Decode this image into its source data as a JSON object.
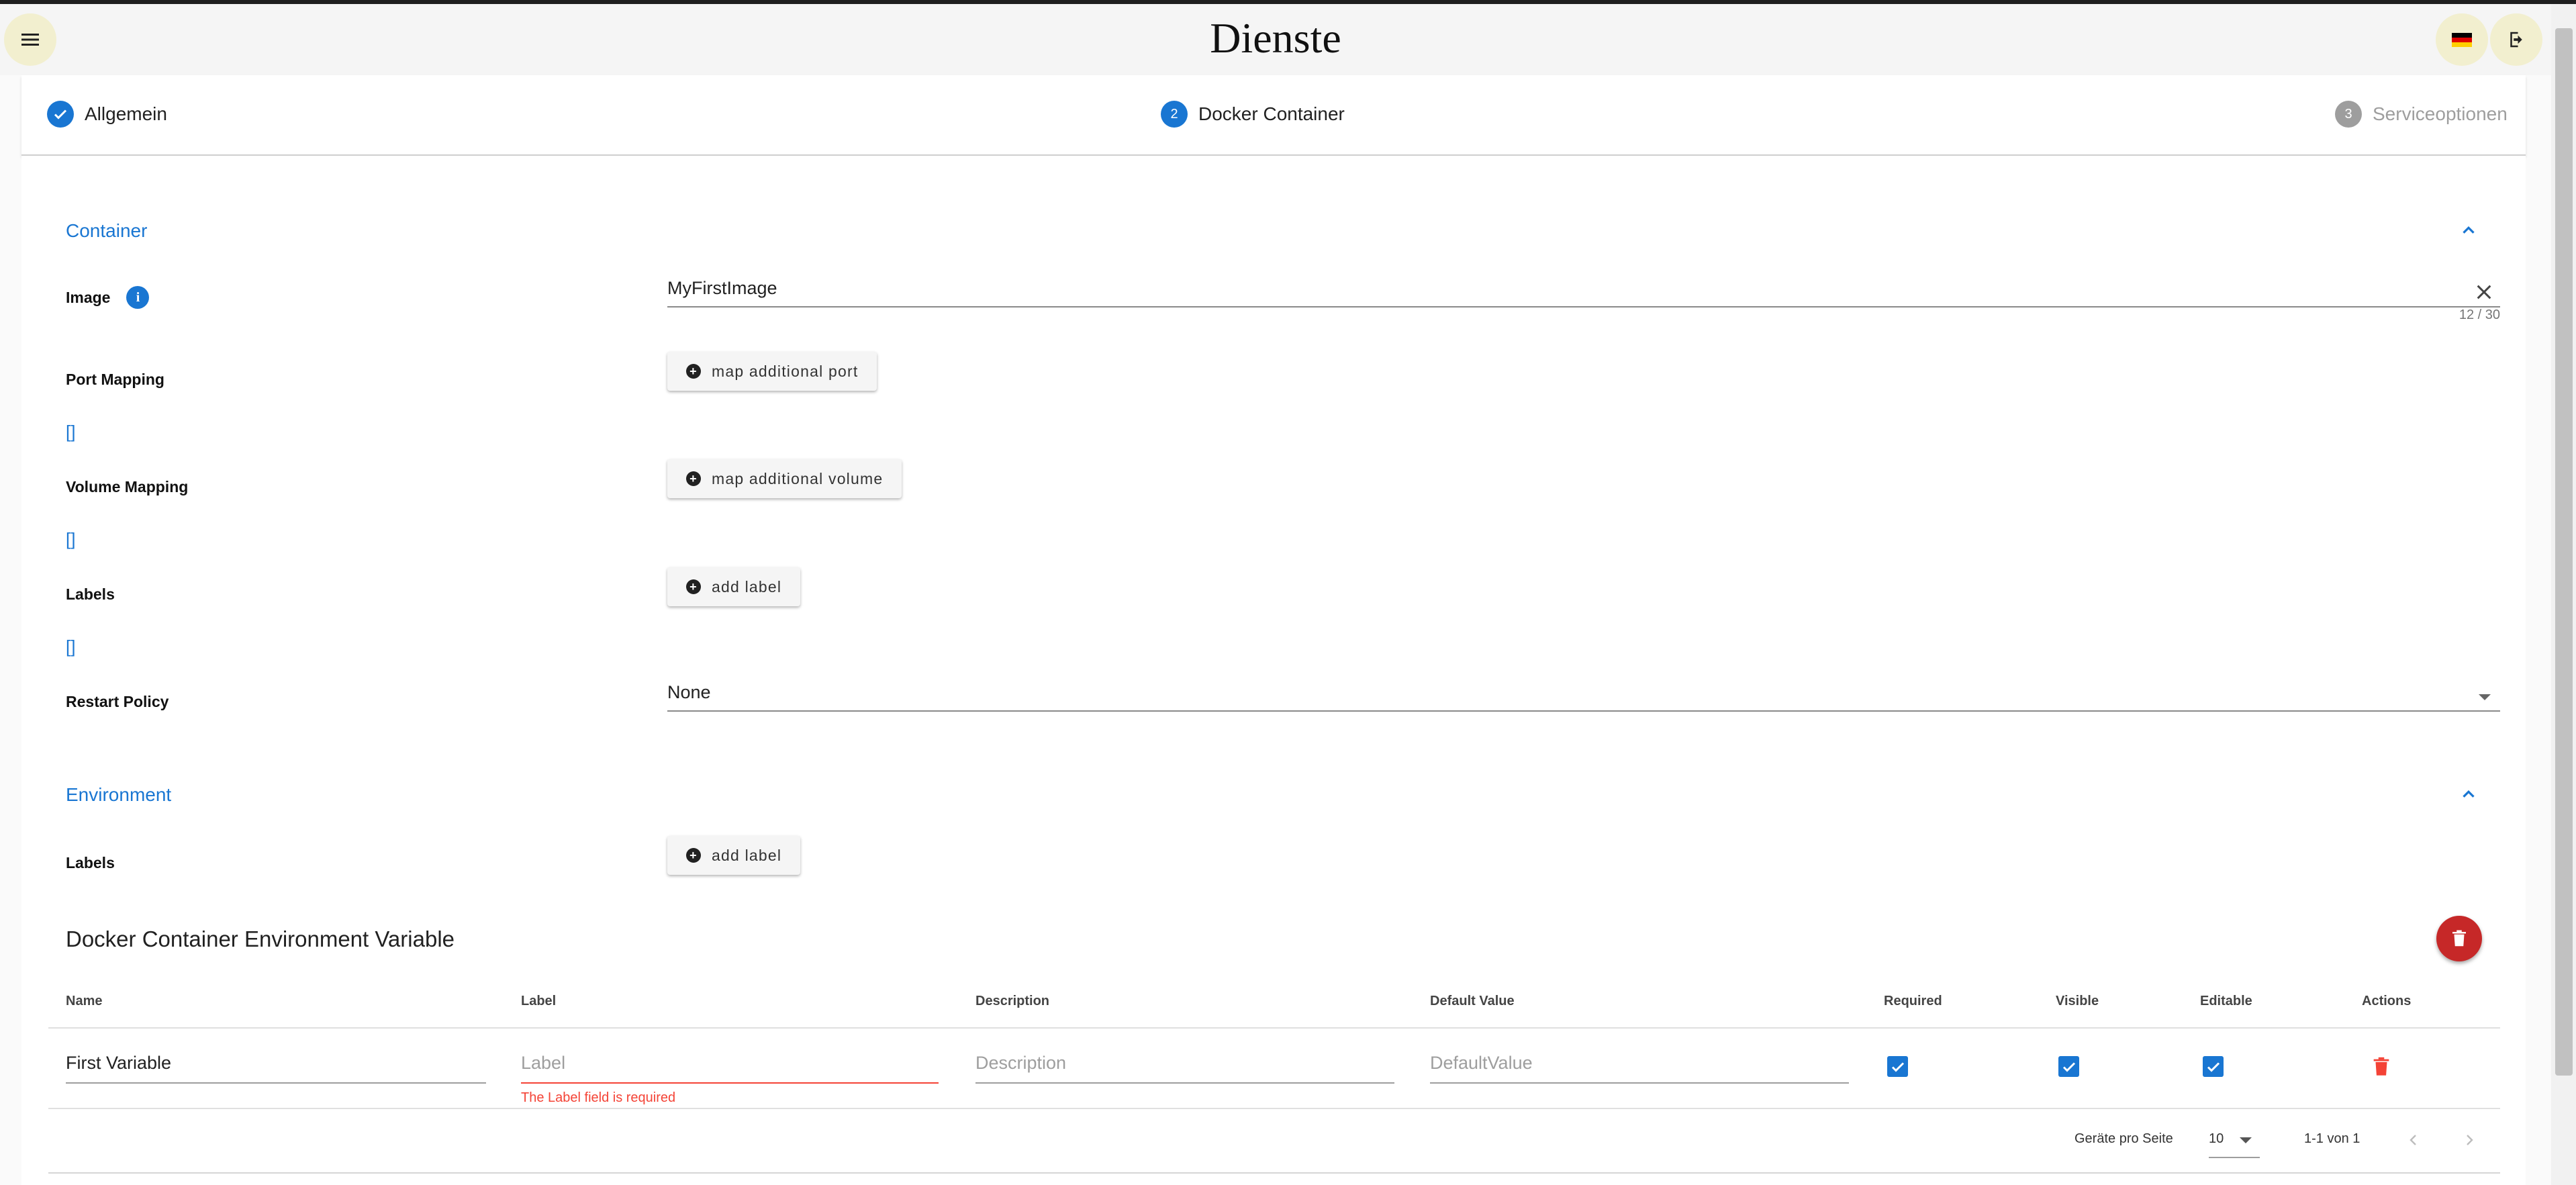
{
  "app": {
    "title": "Dienste"
  },
  "stepper": {
    "steps": [
      {
        "label": "Allgemein",
        "number": "1",
        "state": "done"
      },
      {
        "label": "Docker Container",
        "number": "2",
        "state": "active"
      },
      {
        "label": "Serviceoptionen",
        "number": "3",
        "state": "pending"
      }
    ]
  },
  "container": {
    "section_title": "Container",
    "image_label": "Image",
    "image_value": "MyFirstImage",
    "image_counter": "12 / 30",
    "port_mapping_label": "Port Mapping",
    "port_mapping_value": "[]",
    "port_button": "map additional port",
    "volume_mapping_label": "Volume Mapping",
    "volume_mapping_value": "[]",
    "volume_button": "map additional volume",
    "labels_label": "Labels",
    "labels_value": "[]",
    "labels_button": "add label",
    "restart_policy_label": "Restart Policy",
    "restart_policy_value": "None"
  },
  "environment": {
    "section_title": "Environment",
    "labels_label": "Labels",
    "labels_button": "add label"
  },
  "env_table": {
    "title": "Docker Container Environment Variable",
    "columns": [
      "Name",
      "Label",
      "Description",
      "Default Value",
      "Required",
      "Visible",
      "Editable",
      "Actions"
    ],
    "rows": [
      {
        "name": "First Variable",
        "label_placeholder": "Label",
        "label_error": "The Label field is required",
        "description_placeholder": "Description",
        "default_placeholder": "DefaultValue",
        "required": true,
        "visible": true,
        "editable": true
      }
    ],
    "footer": {
      "per_page_label": "Geräte pro Seite",
      "per_page_value": "10",
      "range": "1-1 von 1"
    }
  },
  "colors": {
    "primary": "#1976d2",
    "danger": "#c62828",
    "error": "#f44336",
    "header_button_bg": "#f2efcf"
  },
  "icons": {
    "menu": "menu-icon",
    "flag": "german-flag-icon",
    "logout": "logout-icon",
    "check": "check-icon",
    "info": "info-icon",
    "clear": "close-icon",
    "plus": "plus-circle-icon",
    "dropdown": "caret-down-icon",
    "collapse": "chevron-up-icon",
    "delete": "trash-icon",
    "prev": "chevron-left-icon",
    "next": "chevron-right-icon"
  }
}
